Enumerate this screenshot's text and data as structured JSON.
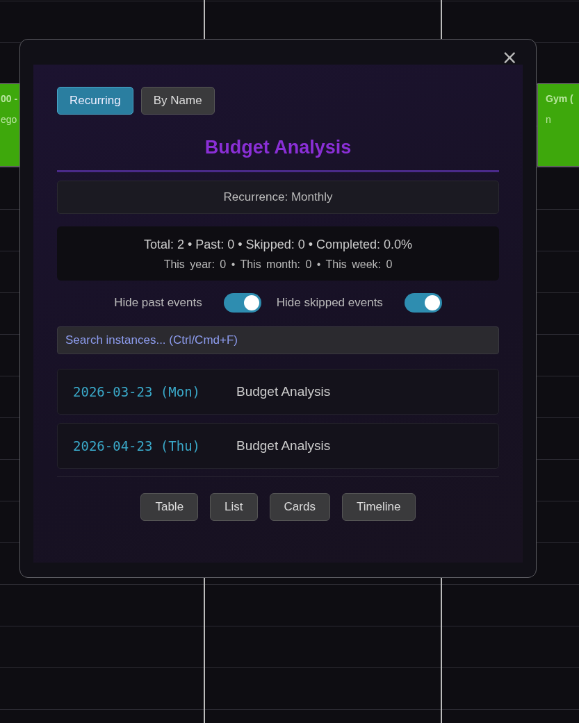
{
  "calendar": {
    "events": [
      {
        "title": "00 -",
        "detail": "ego",
        "color": "#3ea80c"
      },
      {
        "title": "Gym (",
        "detail": "n",
        "color": "#3ea80c"
      }
    ]
  },
  "dialog": {
    "close": "×",
    "tabs": [
      {
        "label": "Recurring",
        "selected": true
      },
      {
        "label": "By Name",
        "selected": false
      }
    ],
    "title": "Budget Analysis",
    "recurrence": "Recurrence: Monthly",
    "stats": {
      "main": "Total: 2 • Past: 0 • Skipped: 0 • Completed: 0.0%",
      "periods": "This year: 0 • This month: 0 • This week: 0"
    },
    "toggles": [
      {
        "label": "Hide past events",
        "on": true
      },
      {
        "label": "Hide skipped events",
        "on": true
      }
    ],
    "search": {
      "placeholder": "Search instances... (Ctrl/Cmd+F)"
    },
    "instances": [
      {
        "date": "2026-03-23 (Mon)",
        "name": "Budget Analysis"
      },
      {
        "date": "2026-04-23 (Thu)",
        "name": "Budget Analysis"
      }
    ],
    "views": [
      "Table",
      "List",
      "Cards",
      "Timeline"
    ]
  }
}
